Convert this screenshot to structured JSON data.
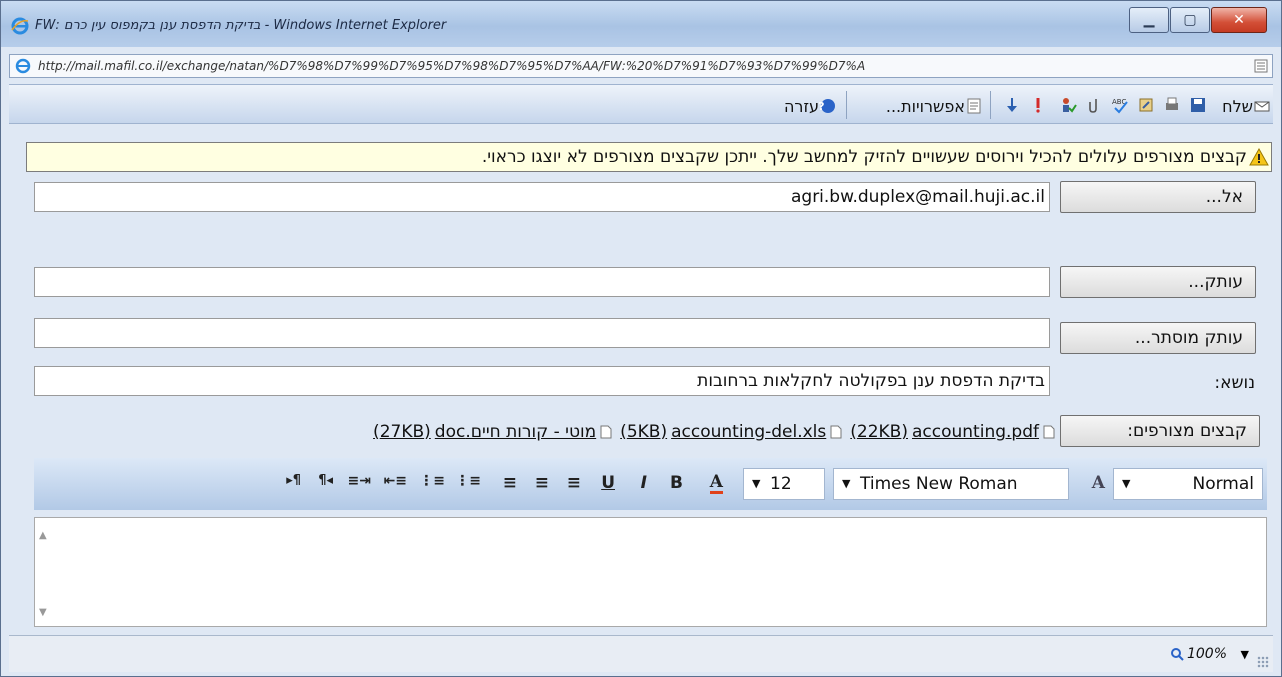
{
  "window": {
    "title": "FW: בדיקת הדפסת ענן בקמפוס עין כרם - Windows Internet Explorer",
    "controls": [
      "minimize",
      "maximize",
      "close"
    ]
  },
  "address": {
    "url": "http://mail.mafil.co.il/exchange/natan/%D7%98%D7%99%D7%95%D7%98%D7%95%D7%AA/FW:%20%D7%91%D7%93%D7%99%D7%A"
  },
  "toolbar": {
    "send_label": "שלח",
    "options_label": "אפשרויות...",
    "help_label": "עזרה"
  },
  "warning": {
    "text": "קבצים מצורפים עלולים להכיל וירוסים שעשויים להזיק למחשב שלך. ייתכן שקבצים מצורפים לא יוצגו כראוי."
  },
  "form": {
    "to_label": "אל...",
    "to_value": "agri.bw.duplex@mail.huji.ac.il",
    "cc_label": "עותק...",
    "cc_value": "",
    "bcc_label": "עותק מוסתר...",
    "bcc_value": "",
    "subject_label": "נושא:",
    "subject_value": "בדיקת הדפסת ענן בפקולטה לחקלאות ברחובות",
    "attachments_label": "קבצים מצורפים:",
    "attachments": [
      {
        "name": "accounting.pdf",
        "size": "(22KB)"
      },
      {
        "name": "accounting-del.xls",
        "size": "(5KB)"
      },
      {
        "name": "מוטי - קורות חיים.doc",
        "size": "(27KB)"
      }
    ]
  },
  "format": {
    "style": "Normal",
    "font": "Times New Roman",
    "size": "12"
  },
  "status": {
    "zoom": "100%"
  }
}
